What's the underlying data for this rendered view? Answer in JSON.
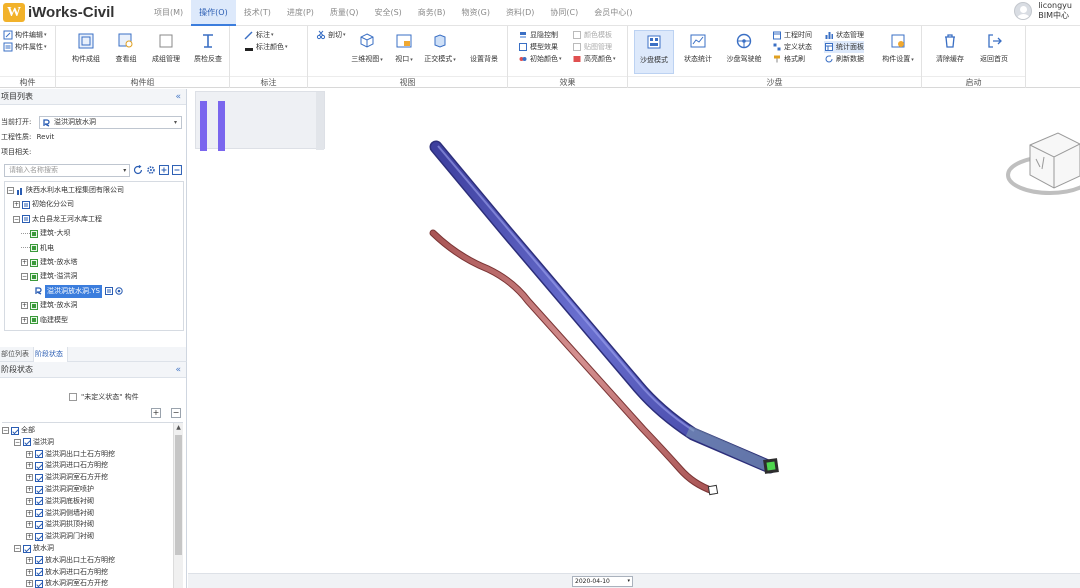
{
  "app": {
    "logo_letter": "W",
    "title": "iWorks-Civil"
  },
  "menu": [
    {
      "label": "项目(M)",
      "active": false
    },
    {
      "label": "操作(O)",
      "active": true
    },
    {
      "label": "技术(T)",
      "active": false
    },
    {
      "label": "进度(P)",
      "active": false
    },
    {
      "label": "质量(Q)",
      "active": false
    },
    {
      "label": "安全(S)",
      "active": false
    },
    {
      "label": "商务(B)",
      "active": false
    },
    {
      "label": "物资(G)",
      "active": false
    },
    {
      "label": "资料(D)",
      "active": false
    },
    {
      "label": "协同(C)",
      "active": false
    },
    {
      "label": "会员中心()",
      "active": false
    }
  ],
  "user": {
    "name": "licongyu",
    "role": "BIM中心"
  },
  "ribbon": {
    "component": {
      "label": "构件",
      "edit": "构件编辑",
      "attr": "构件属性"
    },
    "component_group": {
      "label": "构件组",
      "create": "构件成组",
      "view": "查看组",
      "manage": "成组管理",
      "check": "质检反查"
    },
    "annotation": {
      "label": "标注",
      "mark": "标注",
      "color": "标注颜色"
    },
    "view": {
      "label": "视图",
      "section": "剖切",
      "view3d": "三维视图",
      "viewport": "视口",
      "ortho": "正交模式",
      "bg": "设置背景"
    },
    "effect": {
      "label": "效果",
      "hide": "显隐控制",
      "model": "模型效果",
      "init_color": "初始颜色",
      "color_tpl": "颜色模板",
      "map_mgmt": "贴图管理",
      "highlight": "高亮颜色"
    },
    "sandbox": {
      "label": "沙盘",
      "mode": "沙盘模式",
      "status": "状态统计",
      "drive": "沙盘驾驶舱",
      "project_time": "工程时间",
      "define_status": "定义状态",
      "format_brush": "格式刷",
      "status_mgmt": "状态管理",
      "stat_panel": "统计面板",
      "refresh": "刷新数据",
      "comp_settings": "构件设置"
    },
    "start": {
      "label": "启动",
      "clear": "清除缓存",
      "home": "返回首页"
    }
  },
  "project_panel": {
    "title": "项目列表",
    "current_label": "当前打开:",
    "current_value": "溢洪洞放水洞",
    "type_label": "工程性质:",
    "type_value": "Revit",
    "related_label": "项目相关:",
    "search_placeholder": "请输入名称搜索",
    "tree": [
      {
        "label": "陕西水利水电工程集团有限公司",
        "level": 0
      },
      {
        "label": "初始化分公司",
        "level": 1
      },
      {
        "label": "太白县龙王河水库工程",
        "level": 1
      },
      {
        "label": "建筑-大坝",
        "level": 2
      },
      {
        "label": "机电",
        "level": 2
      },
      {
        "label": "建筑-放水塔",
        "level": 2
      },
      {
        "label": "建筑-溢洪洞",
        "level": 2
      },
      {
        "label": "溢洪洞放水洞.YS",
        "level": 3
      },
      {
        "label": "建筑-放水洞",
        "level": 2
      },
      {
        "label": "临建模型",
        "level": 2
      }
    ]
  },
  "tabs": [
    {
      "label": "部位列表",
      "active": false
    },
    {
      "label": "阶段状态",
      "active": true
    }
  ],
  "stage_panel": {
    "title": "阶段状态",
    "undefined_label": "\"未定义状态\" 构件",
    "plus": "+",
    "minus": "−",
    "tree": [
      {
        "label": "全部",
        "level": 0
      },
      {
        "label": "溢洪洞",
        "level": 1
      },
      {
        "label": "溢洪洞出口土石方明挖",
        "level": 2
      },
      {
        "label": "溢洪洞进口石方明挖",
        "level": 2
      },
      {
        "label": "溢洪洞洞室石方开挖",
        "level": 2
      },
      {
        "label": "溢洪洞洞室喷护",
        "level": 2
      },
      {
        "label": "溢洪洞底板衬砌",
        "level": 2
      },
      {
        "label": "溢洪洞侧墙衬砌",
        "level": 2
      },
      {
        "label": "溢洪洞拱顶衬砌",
        "level": 2
      },
      {
        "label": "溢洪洞洞门衬砌",
        "level": 2
      },
      {
        "label": "放水洞",
        "level": 1
      },
      {
        "label": "放水洞出口土石方明挖",
        "level": 2
      },
      {
        "label": "放水洞进口石方明挖",
        "level": 2
      },
      {
        "label": "放水洞洞室石方开挖",
        "level": 2
      }
    ]
  },
  "viewport": {
    "date": "2020-04-10"
  },
  "colors": {
    "accent": "#3b7ddd",
    "blue_tunnel": "#4b4fae",
    "red_tunnel": "#b86a6a",
    "mini_bar": "#7a66ee"
  }
}
